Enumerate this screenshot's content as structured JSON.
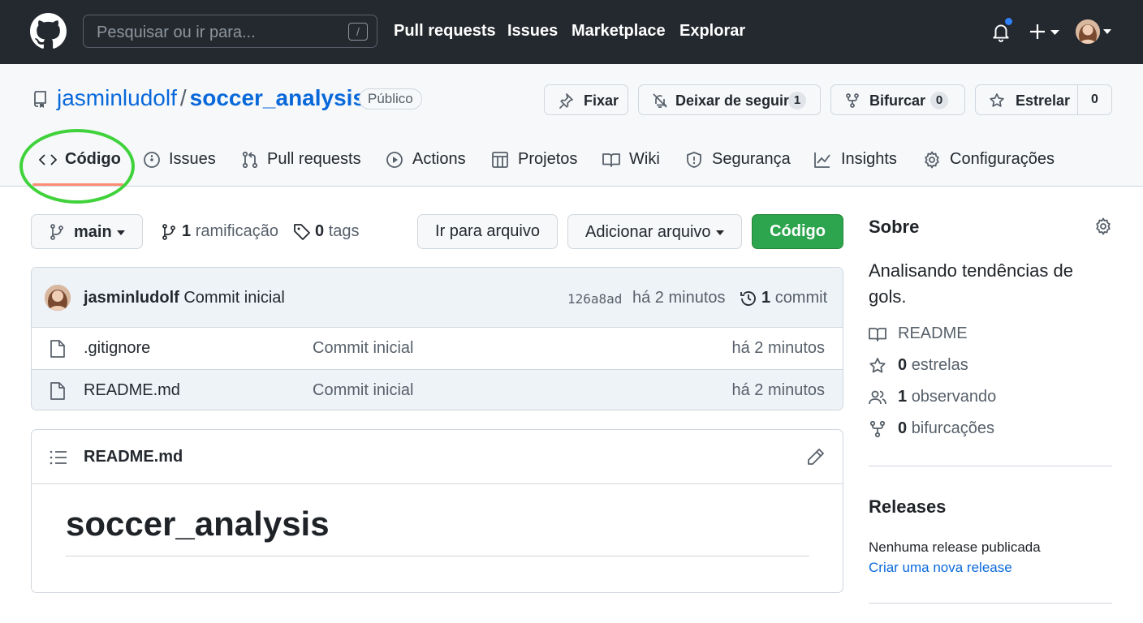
{
  "header": {
    "search_placeholder": "Pesquisar ou ir para...",
    "search_shortcut": "/",
    "nav": [
      "Pull requests",
      "Issues",
      "Marketplace",
      "Explorar"
    ]
  },
  "repo": {
    "owner": "jasminludolf",
    "separator": "/",
    "name": "soccer_analysis",
    "visibility": "Público",
    "actions": {
      "pin_label": "Fixar",
      "unwatch_label": "Deixar de seguir",
      "unwatch_count": "1",
      "fork_label": "Bifurcar",
      "fork_count": "0",
      "star_label": "Estrelar",
      "star_count": "0"
    },
    "tabs": [
      "Código",
      "Issues",
      "Pull requests",
      "Actions",
      "Projetos",
      "Wiki",
      "Segurança",
      "Insights",
      "Configurações"
    ]
  },
  "toolbar": {
    "branch": "main",
    "branches_count": "1",
    "branches_label": "ramificação",
    "tags_count": "0",
    "tags_label": "tags",
    "goto_file": "Ir para arquivo",
    "add_file": "Adicionar arquivo",
    "code_button": "Código"
  },
  "latest_commit": {
    "author": "jasminludolf",
    "message": "Commit inicial",
    "sha": "126a8ad",
    "time": "há 2 minutos",
    "count": "1",
    "count_label": "commit"
  },
  "files": [
    {
      "name": ".gitignore",
      "message": "Commit inicial",
      "time": "há 2 minutos"
    },
    {
      "name": "README.md",
      "message": "Commit inicial",
      "time": "há 2 minutos"
    }
  ],
  "readme": {
    "filename": "README.md",
    "heading": "soccer_analysis"
  },
  "sidebar": {
    "about_title": "Sobre",
    "description": "Analisando tendências de gols.",
    "readme_label": "README",
    "stars_count": "0",
    "stars_label": "estrelas",
    "watching_count": "1",
    "watching_label": "observando",
    "forks_count": "0",
    "forks_label": "bifurcações",
    "releases_title": "Releases",
    "releases_none": "Nenhuma release publicada",
    "releases_create": "Criar uma nova release"
  },
  "colors": {
    "header_bg": "#24292f",
    "link": "#0969da",
    "primary_button": "#2da44e",
    "tab_underline": "#fd8c73",
    "highlight_annotation": "#3fd23a",
    "notification_dot": "#2f81f7"
  }
}
